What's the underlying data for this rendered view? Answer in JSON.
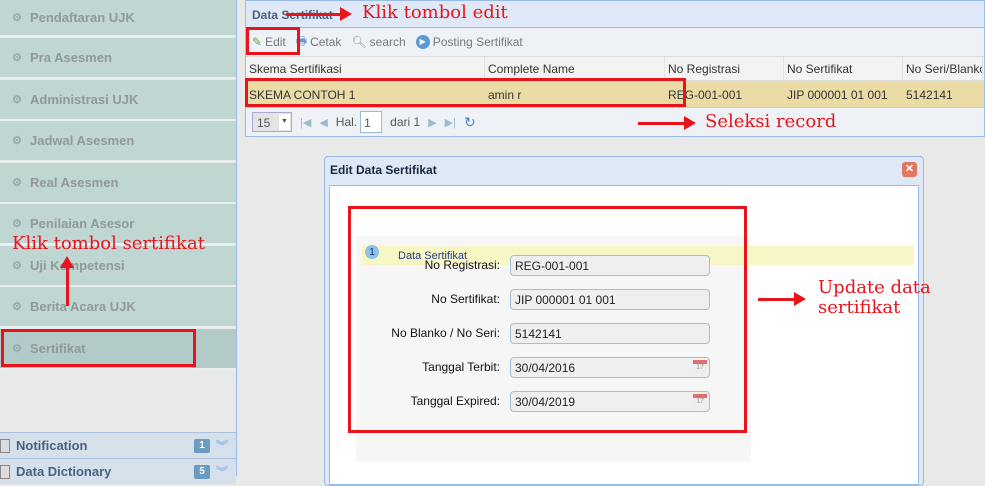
{
  "sidebar": {
    "items": [
      {
        "label": "Pendaftaran UJK"
      },
      {
        "label": "Pra Asesmen"
      },
      {
        "label": "Administrasi UJK"
      },
      {
        "label": "Jadwal Asesmen"
      },
      {
        "label": "Real Asesmen"
      },
      {
        "label": "Penilaian Asesor"
      },
      {
        "label": "Uji Kompetensi"
      },
      {
        "label": "Berita Acara UJK"
      },
      {
        "label": "Sertifikat"
      }
    ],
    "accordions": [
      {
        "label": "Notification",
        "count": "1"
      },
      {
        "label": "Data Dictionary",
        "count": "5"
      }
    ]
  },
  "panel": {
    "title": "Data Sertifikat",
    "toolbar": {
      "edit": "Edit",
      "print": "Cetak",
      "search": "search",
      "posting": "Posting Sertifikat"
    },
    "columns": [
      "Skema Sertifikasi",
      "Complete Name",
      "No Registrasi",
      "No Sertifikat",
      "No Seri/Blanko"
    ],
    "rows": [
      [
        "SKEMA CONTOH 1",
        "amin r",
        "REG-001-001",
        "JIP 000001 01 001",
        "5142141"
      ]
    ],
    "pager": {
      "page_size": "15",
      "page_label": "Hal.",
      "page": "1",
      "of_label": "dari 1"
    }
  },
  "dialog": {
    "title": "Edit Data Sertifikat",
    "section_number": "1",
    "section_title": "Data Sertifikat",
    "fields": [
      {
        "label": "No Registrasi:",
        "value": "REG-001-001"
      },
      {
        "label": "No Sertifikat:",
        "value": "JIP 000001 01 001"
      },
      {
        "label": "No Blanko / No Seri:",
        "value": "5142141"
      },
      {
        "label": "Tanggal Terbit:",
        "value": "30/04/2016"
      },
      {
        "label": "Tanggal Expired:",
        "value": "30/04/2019"
      }
    ],
    "calendar_day": "17"
  },
  "annotations": {
    "edit": "Klik tombol edit",
    "record": "Seleksi record",
    "sertifikat": "Klik tombol sertifikat",
    "update_line1": "Update data",
    "update_line2": "sertifikat"
  },
  "colors": {
    "annotation": "#e8141b",
    "selected_row": "#ebdca6",
    "sidebar": "#bfd6d3"
  }
}
